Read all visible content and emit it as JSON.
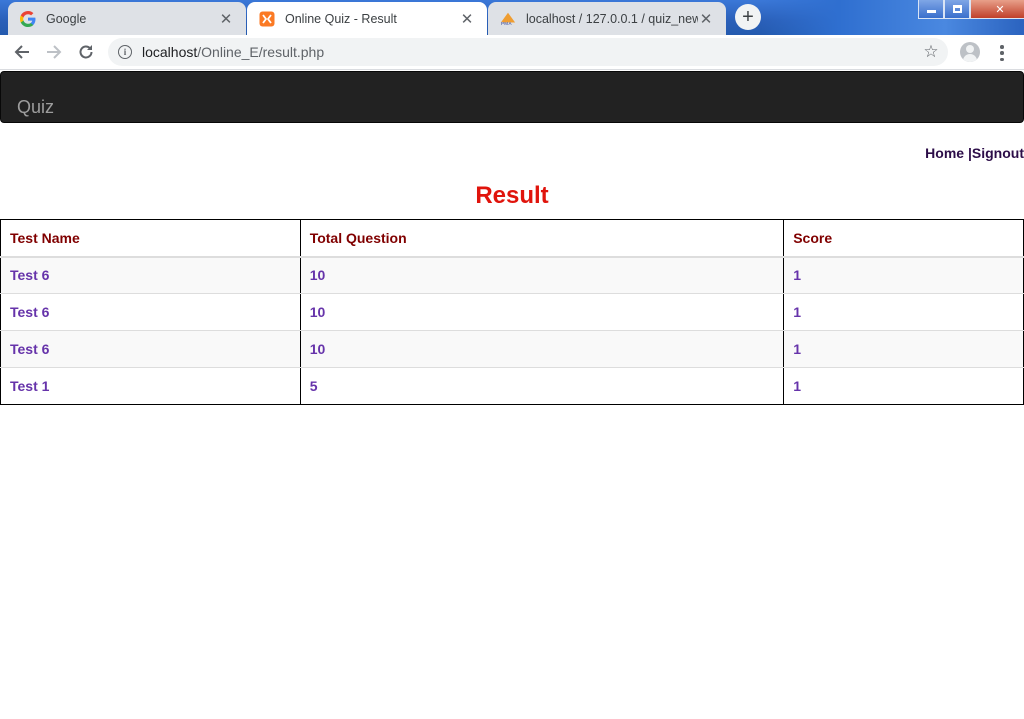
{
  "browser": {
    "tabs": [
      {
        "title": "Google",
        "favicon": "google-g-icon"
      },
      {
        "title": "Online Quiz - Result",
        "favicon": "xampp-icon"
      },
      {
        "title": "localhost / 127.0.0.1 / quiz_new / ",
        "favicon": "phpmyadmin-icon"
      }
    ],
    "url_host": "localhost",
    "url_path": "/Online_E/result.php"
  },
  "navbar": {
    "brand": "Quiz"
  },
  "topnav": {
    "home": "Home",
    "separator": "|",
    "signout": "Signout"
  },
  "page": {
    "title": "Result"
  },
  "table": {
    "headers": [
      "Test Name",
      "Total Question",
      "Score"
    ],
    "rows": [
      [
        "Test 6",
        "10",
        "1"
      ],
      [
        "Test 6",
        "10",
        "1"
      ],
      [
        "Test 6",
        "10",
        "1"
      ],
      [
        "Test 1",
        "5",
        "1"
      ]
    ]
  },
  "colors": {
    "title": "#e0140c",
    "header_text": "#800000",
    "cell_text": "#6633aa",
    "navbar": "#222222"
  }
}
